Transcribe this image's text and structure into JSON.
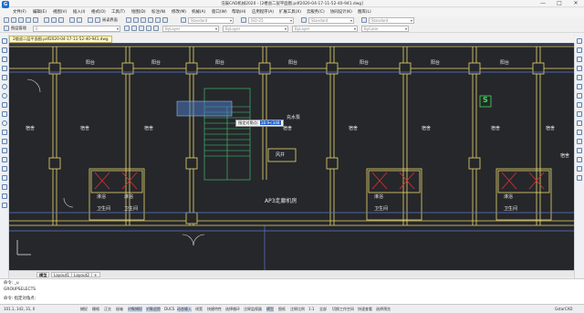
{
  "window": {
    "title": "浩辰CAD机械2020 - [2楼卤二层平面图.pdf2020-04-17-11-52-40-941.dwg]",
    "app_icon_letter": "G",
    "buttons": [
      "—",
      "□",
      "✕"
    ]
  },
  "menu": [
    "文件(F)",
    "编辑(E)",
    "视图(V)",
    "插入(I)",
    "格式(O)",
    "工具(T)",
    "绘图(D)",
    "标注(N)",
    "修改(M)",
    "机械(A)",
    "窗口(W)",
    "帮助(H)",
    "应用程序(A)",
    "扩展工具(X)",
    "云服务(C)",
    "协同设计(K)",
    "图库(L)"
  ],
  "toolbar": {
    "quick_tab": "阅读界面",
    "style_combo": "Standard",
    "dim_combo": "ISO-25",
    "table_combo": "Standard",
    "mleader_combo": "Standard",
    "layer_combo": "0",
    "color_combo": "ByLayer",
    "linetype_combo": "ByLayer",
    "lineweight_combo": "ByLayer",
    "plot_combo": "ByColor",
    "layer_mgr": "图层管理"
  },
  "document_tab": "2楼卤二层平面图.pdf2020-04-17-11-52-40-941.dwg",
  "canvas": {
    "room_labels_top": [
      "阳台",
      "阳台",
      "阳台",
      "阳台",
      "阳台",
      "阳台",
      "阳台"
    ],
    "room_labels_mid": [
      "宿舍",
      "宿舍",
      "宿舍",
      "宿舍",
      "宿舍",
      "宿舍",
      "宿舍",
      "宿舍",
      "宿舍"
    ],
    "stair_label": "充水泵",
    "shaft_label": "风井",
    "ap_label": "AP3走廊机房",
    "wash_labels": [
      "淋浴",
      "淋浴",
      "淋浴",
      "淋浴"
    ],
    "toilet_labels": [
      "卫生间",
      "卫生间",
      "卫生间",
      "卫生间"
    ],
    "marker_symbol": "S",
    "tooltip_label": "指定对角点:",
    "tooltip_value": "18.9<348"
  },
  "layout_tabs": [
    "模型",
    "Layout1",
    "Layout2",
    "+"
  ],
  "command": {
    "line1": "命令: _u",
    "line2": "GROUPSELECTS",
    "line3": "命令: 指定对角点:"
  },
  "status": {
    "coords": "101.1, 142, 31, 0",
    "toggles": [
      "捕捉",
      "栅格",
      "正交",
      "极轴",
      "对象捕捉",
      "对象追踪",
      "DUCS",
      "动态输入",
      "线宽",
      "快捷特性",
      "选择循环",
      "注释监视器",
      "模型",
      "图纸",
      "注释比例",
      "1:1",
      "全部",
      "切换工作空间",
      "快速查看",
      "选择预览"
    ],
    "right_label": "GstarCAD"
  }
}
